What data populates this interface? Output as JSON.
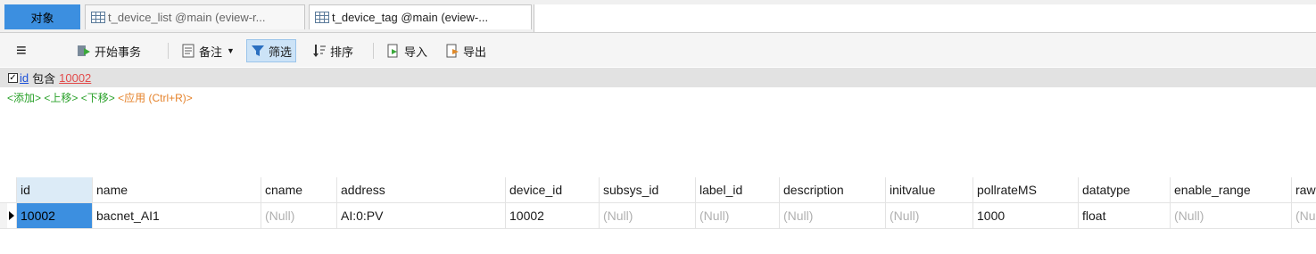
{
  "tabs": {
    "objects_label": "对象",
    "doc1_label": "t_device_list @main (eview-r...",
    "doc2_label": "t_device_tag @main (eview-..."
  },
  "toolbar": {
    "menu_icon": "≡",
    "begin_transaction": "开始事务",
    "note": "备注",
    "filter": "筛选",
    "sort": "排序",
    "import": "导入",
    "export": "导出"
  },
  "filter": {
    "field": "id",
    "operator": "包含",
    "value": "10002",
    "actions": {
      "add": "<添加>",
      "up": "<上移>",
      "down": "<下移>",
      "apply": "<应用 (Ctrl+R)>"
    }
  },
  "grid": {
    "columns": [
      "id",
      "name",
      "cname",
      "address",
      "device_id",
      "subsys_id",
      "label_id",
      "description",
      "initvalue",
      "pollrateMS",
      "datatype",
      "enable_range",
      "raw"
    ],
    "rows": [
      [
        "10002",
        "bacnet_AI1",
        "(Null)",
        "AI:0:PV",
        "10002",
        "(Null)",
        "(Null)",
        "(Null)",
        "(Null)",
        "1000",
        "float",
        "(Null)",
        "(Nu"
      ]
    ]
  },
  "colors": {
    "accent": "#3c8fe0",
    "null_text": "#b0b0b0",
    "action_green": "#2aa12a",
    "action_orange": "#e5822a"
  }
}
